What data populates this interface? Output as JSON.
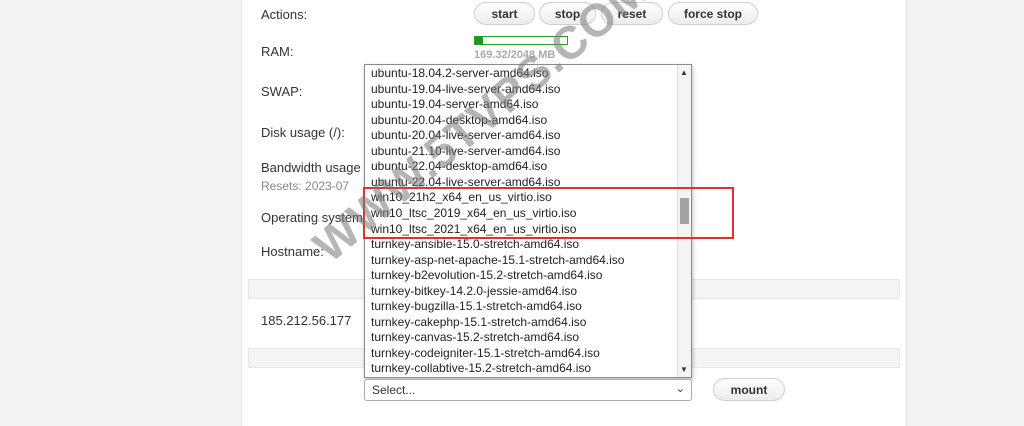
{
  "actions": {
    "label": "Actions:",
    "start": "start",
    "stop": "stop",
    "reset": "reset",
    "force_stop": "force stop"
  },
  "ram": {
    "label": "RAM:",
    "used_mb": 169.32,
    "total_mb": 2048,
    "text": "169.32/2048 MB"
  },
  "swap": {
    "label": "SWAP:"
  },
  "disk": {
    "label": "Disk usage (/):"
  },
  "bandwidth": {
    "label": "Bandwidth usage",
    "resets": "Resets: 2023-07"
  },
  "os": {
    "label": "Operating system"
  },
  "hostname": {
    "label": "Hostname:"
  },
  "ip": "185.212.56.177",
  "iso_list": {
    "options": [
      "ubuntu-18.04.2-server-amd64.iso",
      "ubuntu-19.04-live-server-amd64.iso",
      "ubuntu-19.04-server-amd64.iso",
      "ubuntu-20.04-desktop-amd64.iso",
      "ubuntu-20.04-live-server-amd64.iso",
      "ubuntu-21.10-live-server-amd64.iso",
      "ubuntu-22.04-desktop-amd64.iso",
      "ubuntu-22.04-live-server-amd64.iso",
      "win10_21h2_x64_en_us_virtio.iso",
      "win10_ltsc_2019_x64_en_us_virtio.iso",
      "win10_ltsc_2021_x64_en_us_virtio.iso",
      "turnkey-ansible-15.0-stretch-amd64.iso",
      "turnkey-asp-net-apache-15.1-stretch-amd64.iso",
      "turnkey-b2evolution-15.2-stretch-amd64.iso",
      "turnkey-bitkey-14.2.0-jessie-amd64.iso",
      "turnkey-bugzilla-15.1-stretch-amd64.iso",
      "turnkey-cakephp-15.1-stretch-amd64.iso",
      "turnkey-canvas-15.2-stretch-amd64.iso",
      "turnkey-codeigniter-15.1-stretch-amd64.iso",
      "turnkey-collabtive-15.2-stretch-amd64.iso"
    ],
    "scroll_up_icon": "triangle-up",
    "scroll_down_icon": "triangle-down"
  },
  "iso_select": {
    "value": "Select...",
    "chevron_icon": "chevron-down"
  },
  "mount_label": "mount",
  "watermark": "WWW.5TVPS.COM",
  "colors": {
    "highlight": "#e03030",
    "ram_fill": "#1a9a1a"
  }
}
